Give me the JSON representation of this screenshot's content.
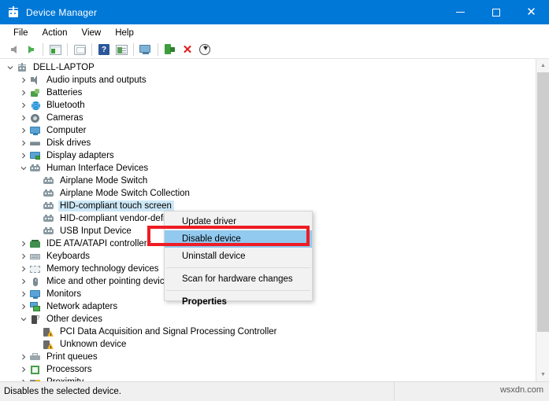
{
  "window": {
    "title": "Device Manager",
    "title_icon": "device-manager-icon",
    "minimize_label": "─",
    "maximize_label": "",
    "close_label": "✕",
    "accent_color": "#0078d7"
  },
  "menubar": {
    "items": [
      {
        "label": "File"
      },
      {
        "label": "Action"
      },
      {
        "label": "View"
      },
      {
        "label": "Help"
      }
    ]
  },
  "toolbar": {
    "buttons": [
      {
        "name": "back-arrow-icon",
        "kind": "arrow-left"
      },
      {
        "name": "forward-arrow-icon",
        "kind": "arrow-right"
      },
      {
        "name": "show-hidden-devices-icon",
        "kind": "box-green"
      },
      {
        "name": "properties-window-icon",
        "kind": "screen"
      },
      {
        "name": "help-icon",
        "kind": "help",
        "glyph": "?"
      },
      {
        "name": "device-properties-icon",
        "kind": "props"
      },
      {
        "name": "console-icon",
        "kind": "monitor"
      },
      {
        "name": "update-driver-icon",
        "kind": "scan"
      },
      {
        "name": "uninstall-device-icon",
        "kind": "x",
        "glyph": "✕"
      },
      {
        "name": "scan-hardware-changes-icon",
        "kind": "download"
      }
    ]
  },
  "tree": {
    "root": {
      "label": "DELL-LAPTOP",
      "icon": "computer-root-icon",
      "expanded": true
    },
    "nodes": [
      {
        "label": "Audio inputs and outputs",
        "icon": "speaker-icon",
        "depth": 1,
        "expandable": true,
        "expanded": false,
        "selected": false
      },
      {
        "label": "Batteries",
        "icon": "battery-icon",
        "depth": 1,
        "expandable": true,
        "expanded": false,
        "selected": false
      },
      {
        "label": "Bluetooth",
        "icon": "bluetooth-icon",
        "depth": 1,
        "expandable": true,
        "expanded": false,
        "selected": false
      },
      {
        "label": "Cameras",
        "icon": "camera-icon",
        "depth": 1,
        "expandable": true,
        "expanded": false,
        "selected": false
      },
      {
        "label": "Computer",
        "icon": "computer-icon",
        "depth": 1,
        "expandable": true,
        "expanded": false,
        "selected": false
      },
      {
        "label": "Disk drives",
        "icon": "disk-drive-icon",
        "depth": 1,
        "expandable": true,
        "expanded": false,
        "selected": false
      },
      {
        "label": "Display adapters",
        "icon": "display-adapter-icon",
        "depth": 1,
        "expandable": true,
        "expanded": false,
        "selected": false
      },
      {
        "label": "Human Interface Devices",
        "icon": "hid-icon",
        "depth": 1,
        "expandable": true,
        "expanded": true,
        "selected": false
      },
      {
        "label": "Airplane Mode Switch",
        "icon": "hid-icon",
        "depth": 2,
        "expandable": false,
        "expanded": false,
        "selected": false
      },
      {
        "label": "Airplane Mode Switch Collection",
        "icon": "hid-icon",
        "depth": 2,
        "expandable": false,
        "expanded": false,
        "selected": false
      },
      {
        "label": "HID-compliant touch screen",
        "icon": "hid-icon",
        "depth": 2,
        "expandable": false,
        "expanded": false,
        "selected": true
      },
      {
        "label": "HID-compliant vendor-defined device",
        "icon": "hid-icon",
        "depth": 2,
        "expandable": false,
        "expanded": false,
        "selected": false
      },
      {
        "label": "USB Input Device",
        "icon": "hid-icon",
        "depth": 2,
        "expandable": false,
        "expanded": false,
        "selected": false
      },
      {
        "label": "IDE ATA/ATAPI controllers",
        "icon": "ide-controller-icon",
        "depth": 1,
        "expandable": true,
        "expanded": false,
        "selected": false
      },
      {
        "label": "Keyboards",
        "icon": "keyboard-icon",
        "depth": 1,
        "expandable": true,
        "expanded": false,
        "selected": false
      },
      {
        "label": "Memory technology devices",
        "icon": "memory-icon",
        "depth": 1,
        "expandable": true,
        "expanded": false,
        "selected": false
      },
      {
        "label": "Mice and other pointing devices",
        "icon": "mouse-icon",
        "depth": 1,
        "expandable": true,
        "expanded": false,
        "selected": false
      },
      {
        "label": "Monitors",
        "icon": "monitor-icon",
        "depth": 1,
        "expandable": true,
        "expanded": false,
        "selected": false
      },
      {
        "label": "Network adapters",
        "icon": "network-adapter-icon",
        "depth": 1,
        "expandable": true,
        "expanded": false,
        "selected": false
      },
      {
        "label": "Other devices",
        "icon": "other-device-icon",
        "depth": 1,
        "expandable": true,
        "expanded": true,
        "selected": false
      },
      {
        "label": "PCI Data Acquisition and Signal Processing Controller",
        "icon": "warning-device-icon",
        "depth": 2,
        "expandable": false,
        "expanded": false,
        "selected": false
      },
      {
        "label": "Unknown device",
        "icon": "warning-device-icon",
        "depth": 2,
        "expandable": false,
        "expanded": false,
        "selected": false
      },
      {
        "label": "Print queues",
        "icon": "print-queue-icon",
        "depth": 1,
        "expandable": true,
        "expanded": false,
        "selected": false
      },
      {
        "label": "Processors",
        "icon": "processor-icon",
        "depth": 1,
        "expandable": true,
        "expanded": false,
        "selected": false
      },
      {
        "label": "Proximity",
        "icon": "proximity-icon",
        "depth": 1,
        "expandable": true,
        "expanded": false,
        "selected": false
      }
    ]
  },
  "context_menu": {
    "items": [
      {
        "label": "Update driver",
        "highlighted": false,
        "bold": false,
        "separator_after": false
      },
      {
        "label": "Disable device",
        "highlighted": true,
        "bold": false,
        "separator_after": false
      },
      {
        "label": "Uninstall device",
        "highlighted": false,
        "bold": false,
        "separator_after": true
      },
      {
        "label": "Scan for hardware changes",
        "highlighted": false,
        "bold": false,
        "separator_after": true
      },
      {
        "label": "Properties",
        "highlighted": false,
        "bold": true,
        "separator_after": false
      }
    ],
    "highlight_color": "#91c9ef",
    "annotation_box_color": "#ee1c25"
  },
  "statusbar": {
    "text": "Disables the selected device.",
    "watermark": "wsxdn.com"
  },
  "scrollbar": {
    "up_arrow": "▲",
    "down_arrow": "▼"
  }
}
